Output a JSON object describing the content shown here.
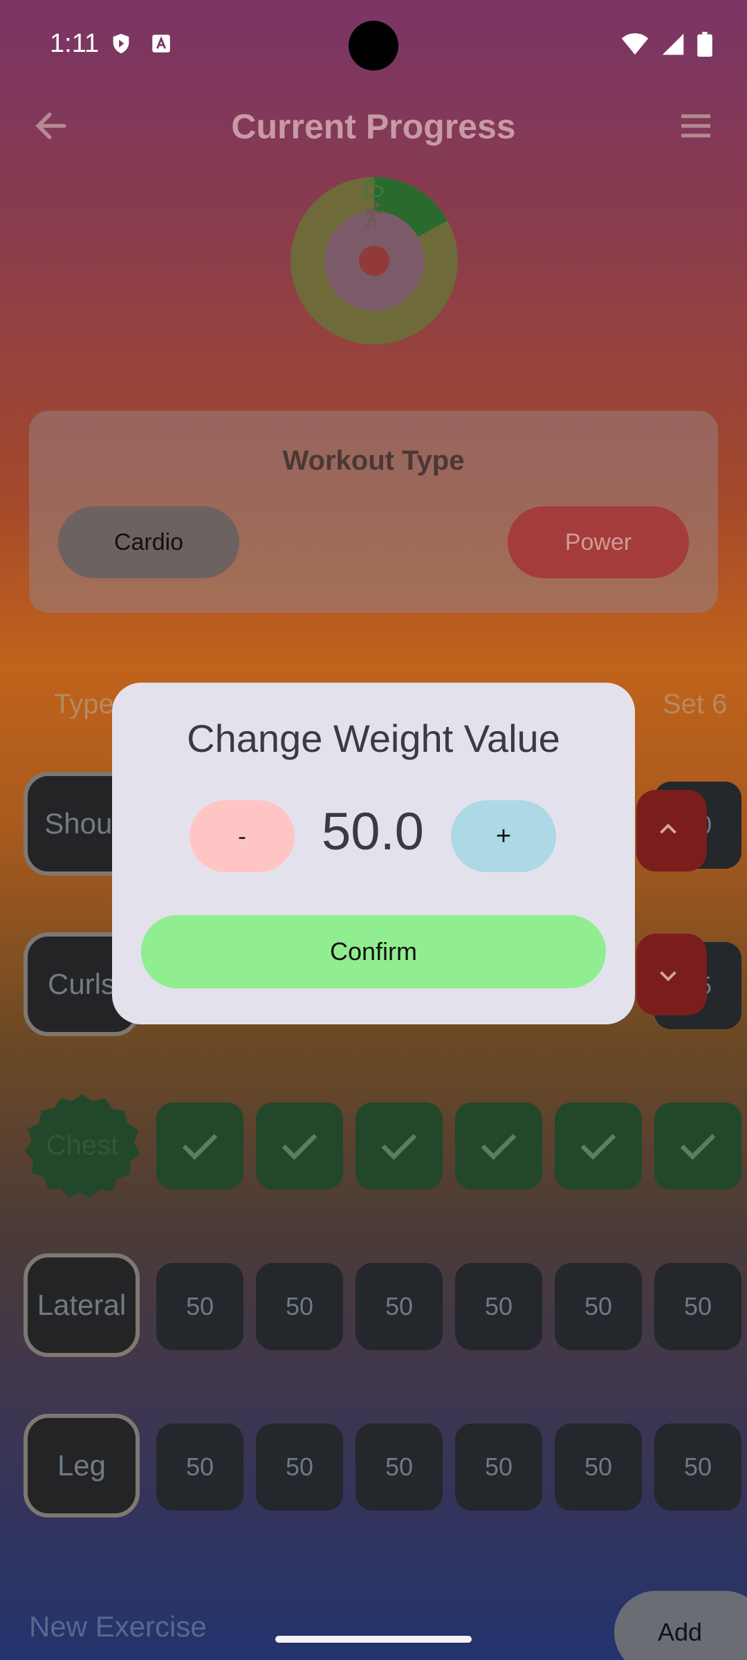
{
  "status_bar": {
    "time": "1:11"
  },
  "app_bar": {
    "title": "Current Progress"
  },
  "workout_card": {
    "title": "Workout Type",
    "cardio_label": "Cardio",
    "power_label": "Power"
  },
  "table": {
    "type_header": "Type",
    "set_header": "Set 6",
    "rows": [
      {
        "label": "Shoul",
        "last_value": "50"
      },
      {
        "label": "Curls",
        "last_value": "95"
      },
      {
        "label": "Chest"
      },
      {
        "label": "Lateral",
        "values": [
          "50",
          "50",
          "50",
          "50",
          "50",
          "50"
        ]
      },
      {
        "label": "Leg",
        "values": [
          "50",
          "50",
          "50",
          "50",
          "50",
          "50"
        ]
      }
    ]
  },
  "bottom": {
    "new_exercise_placeholder": "New Exercise",
    "add_label": "Add"
  },
  "dialog": {
    "title": "Change Weight Value",
    "minus_label": "-",
    "value": "50.0",
    "plus_label": "+",
    "confirm_label": "Confirm"
  },
  "colors": {
    "dialog_bg": "#e3e2ec",
    "minus_bg": "#ffc5c5",
    "plus_bg": "#add8e6",
    "confirm_bg": "#90ee90",
    "done_cell": "#23472a"
  },
  "icons": [
    "shield-icon",
    "translate-icon",
    "wifi-icon",
    "signal-icon",
    "battery-icon",
    "back-arrow-icon",
    "hamburger-menu-icon",
    "bicep-icon",
    "runner-icon",
    "check-icon",
    "chevron-up-icon",
    "chevron-down-icon"
  ]
}
